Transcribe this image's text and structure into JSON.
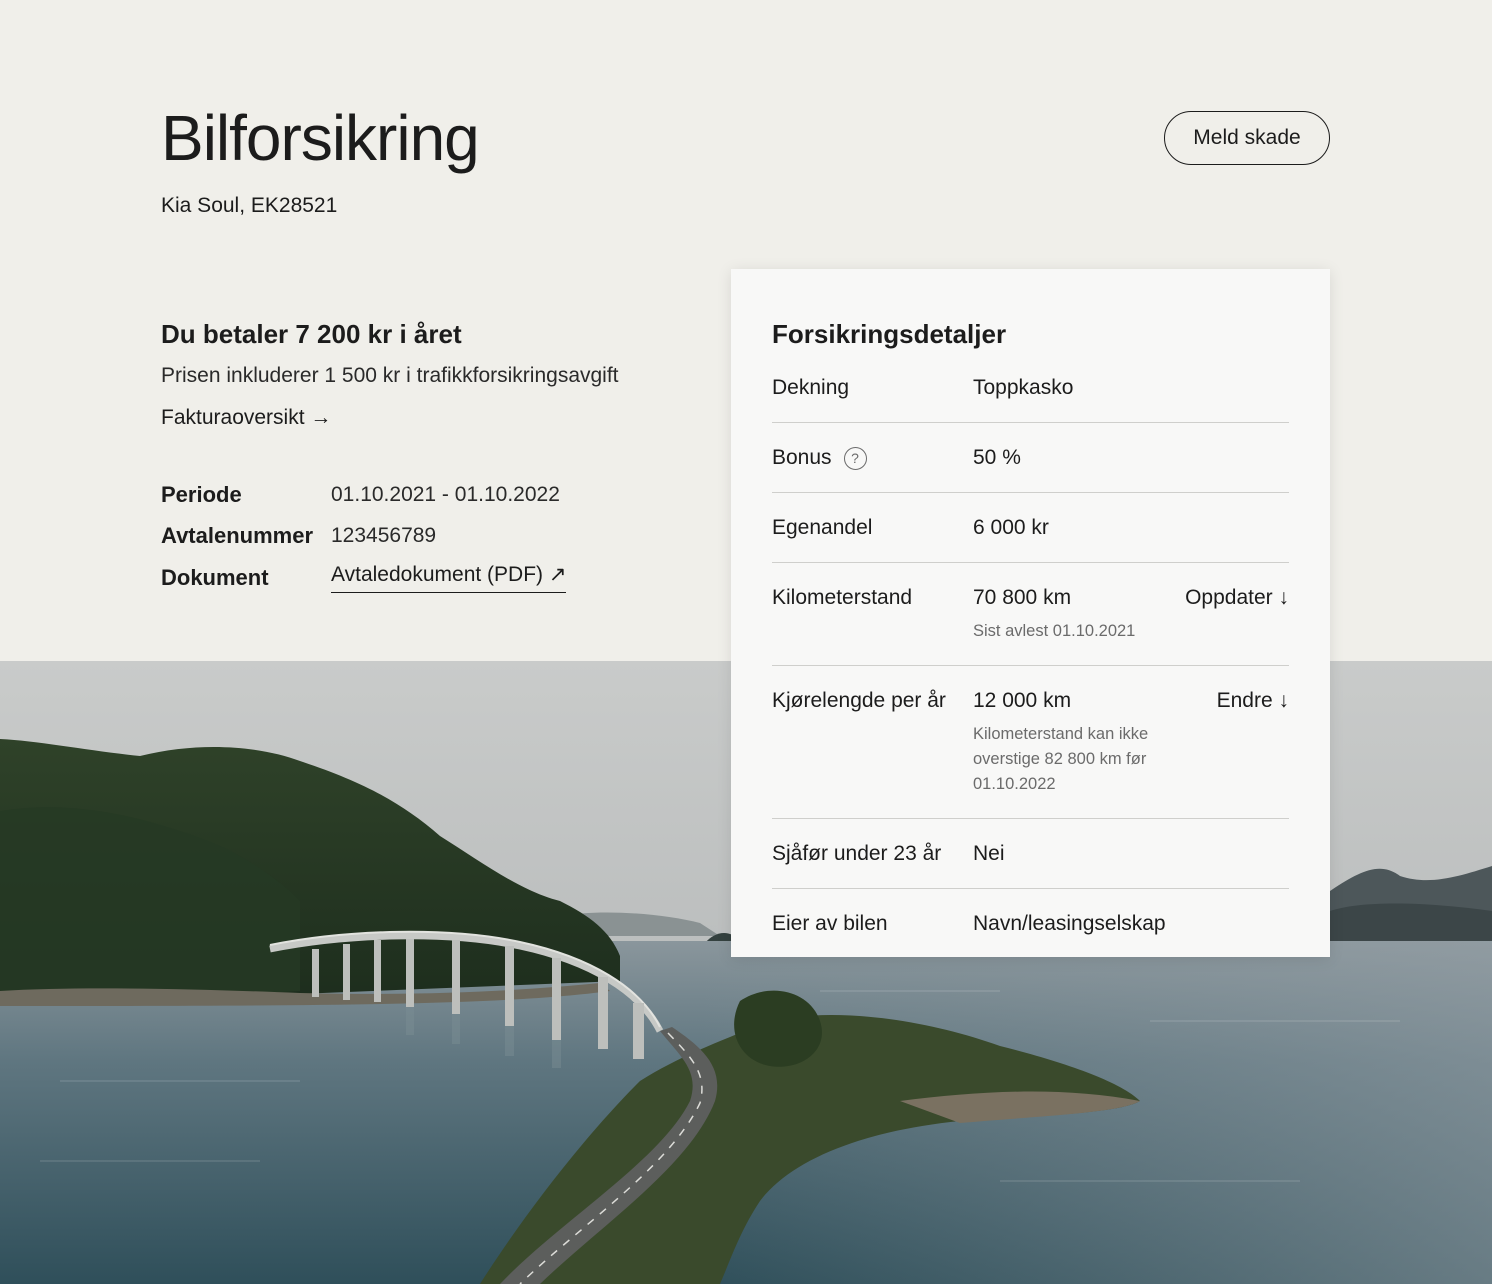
{
  "header": {
    "title": "Bilforsikring",
    "subtitle": "Kia Soul, EK28521",
    "report_damage_label": "Meld skade"
  },
  "summary": {
    "price_heading": "Du betaler 7 200 kr i året",
    "price_note": "Prisen inkluderer 1 500 kr i trafikkforsikringsavgift",
    "invoice_link": "Fakturaoversikt →",
    "period_label": "Periode",
    "period_value": "01.10.2021 - 01.10.2022",
    "agreement_label": "Avtalenummer",
    "agreement_value": "123456789",
    "document_label": "Dokument",
    "document_link": "Avtaledokument (PDF) ↗"
  },
  "details": {
    "title": "Forsikringsdetaljer",
    "rows": [
      {
        "label": "Dekning",
        "value": "Toppkasko"
      },
      {
        "label": "Bonus",
        "value": "50 %",
        "help_icon": "?"
      },
      {
        "label": "Egenandel",
        "value": "6 000 kr"
      },
      {
        "label": "Kilometerstand",
        "value": "70 800 km",
        "note": "Sist avlest 01.10.2021",
        "action": "Oppdater ↓"
      },
      {
        "label": "Kjørelengde per år",
        "value": "12 000 km",
        "note": "Kilometerstand kan ikke overstige 82 800 km før 01.10.2022",
        "action": "Endre ↓"
      },
      {
        "label": "Sjåfør under 23 år",
        "value": "Nei"
      },
      {
        "label": "Eier av bilen",
        "value": "Navn/leasingselskap"
      }
    ]
  },
  "colors": {
    "background": "#f0efea",
    "card": "#f8f8f7",
    "text": "#1c1c1c",
    "muted": "#6b6b6b",
    "divider": "#cfcfcc"
  },
  "icons": {
    "help": "question-circle-icon",
    "invoice_arrow": "arrow-right-icon",
    "external": "arrow-up-right-icon",
    "expand": "arrow-down-icon"
  }
}
